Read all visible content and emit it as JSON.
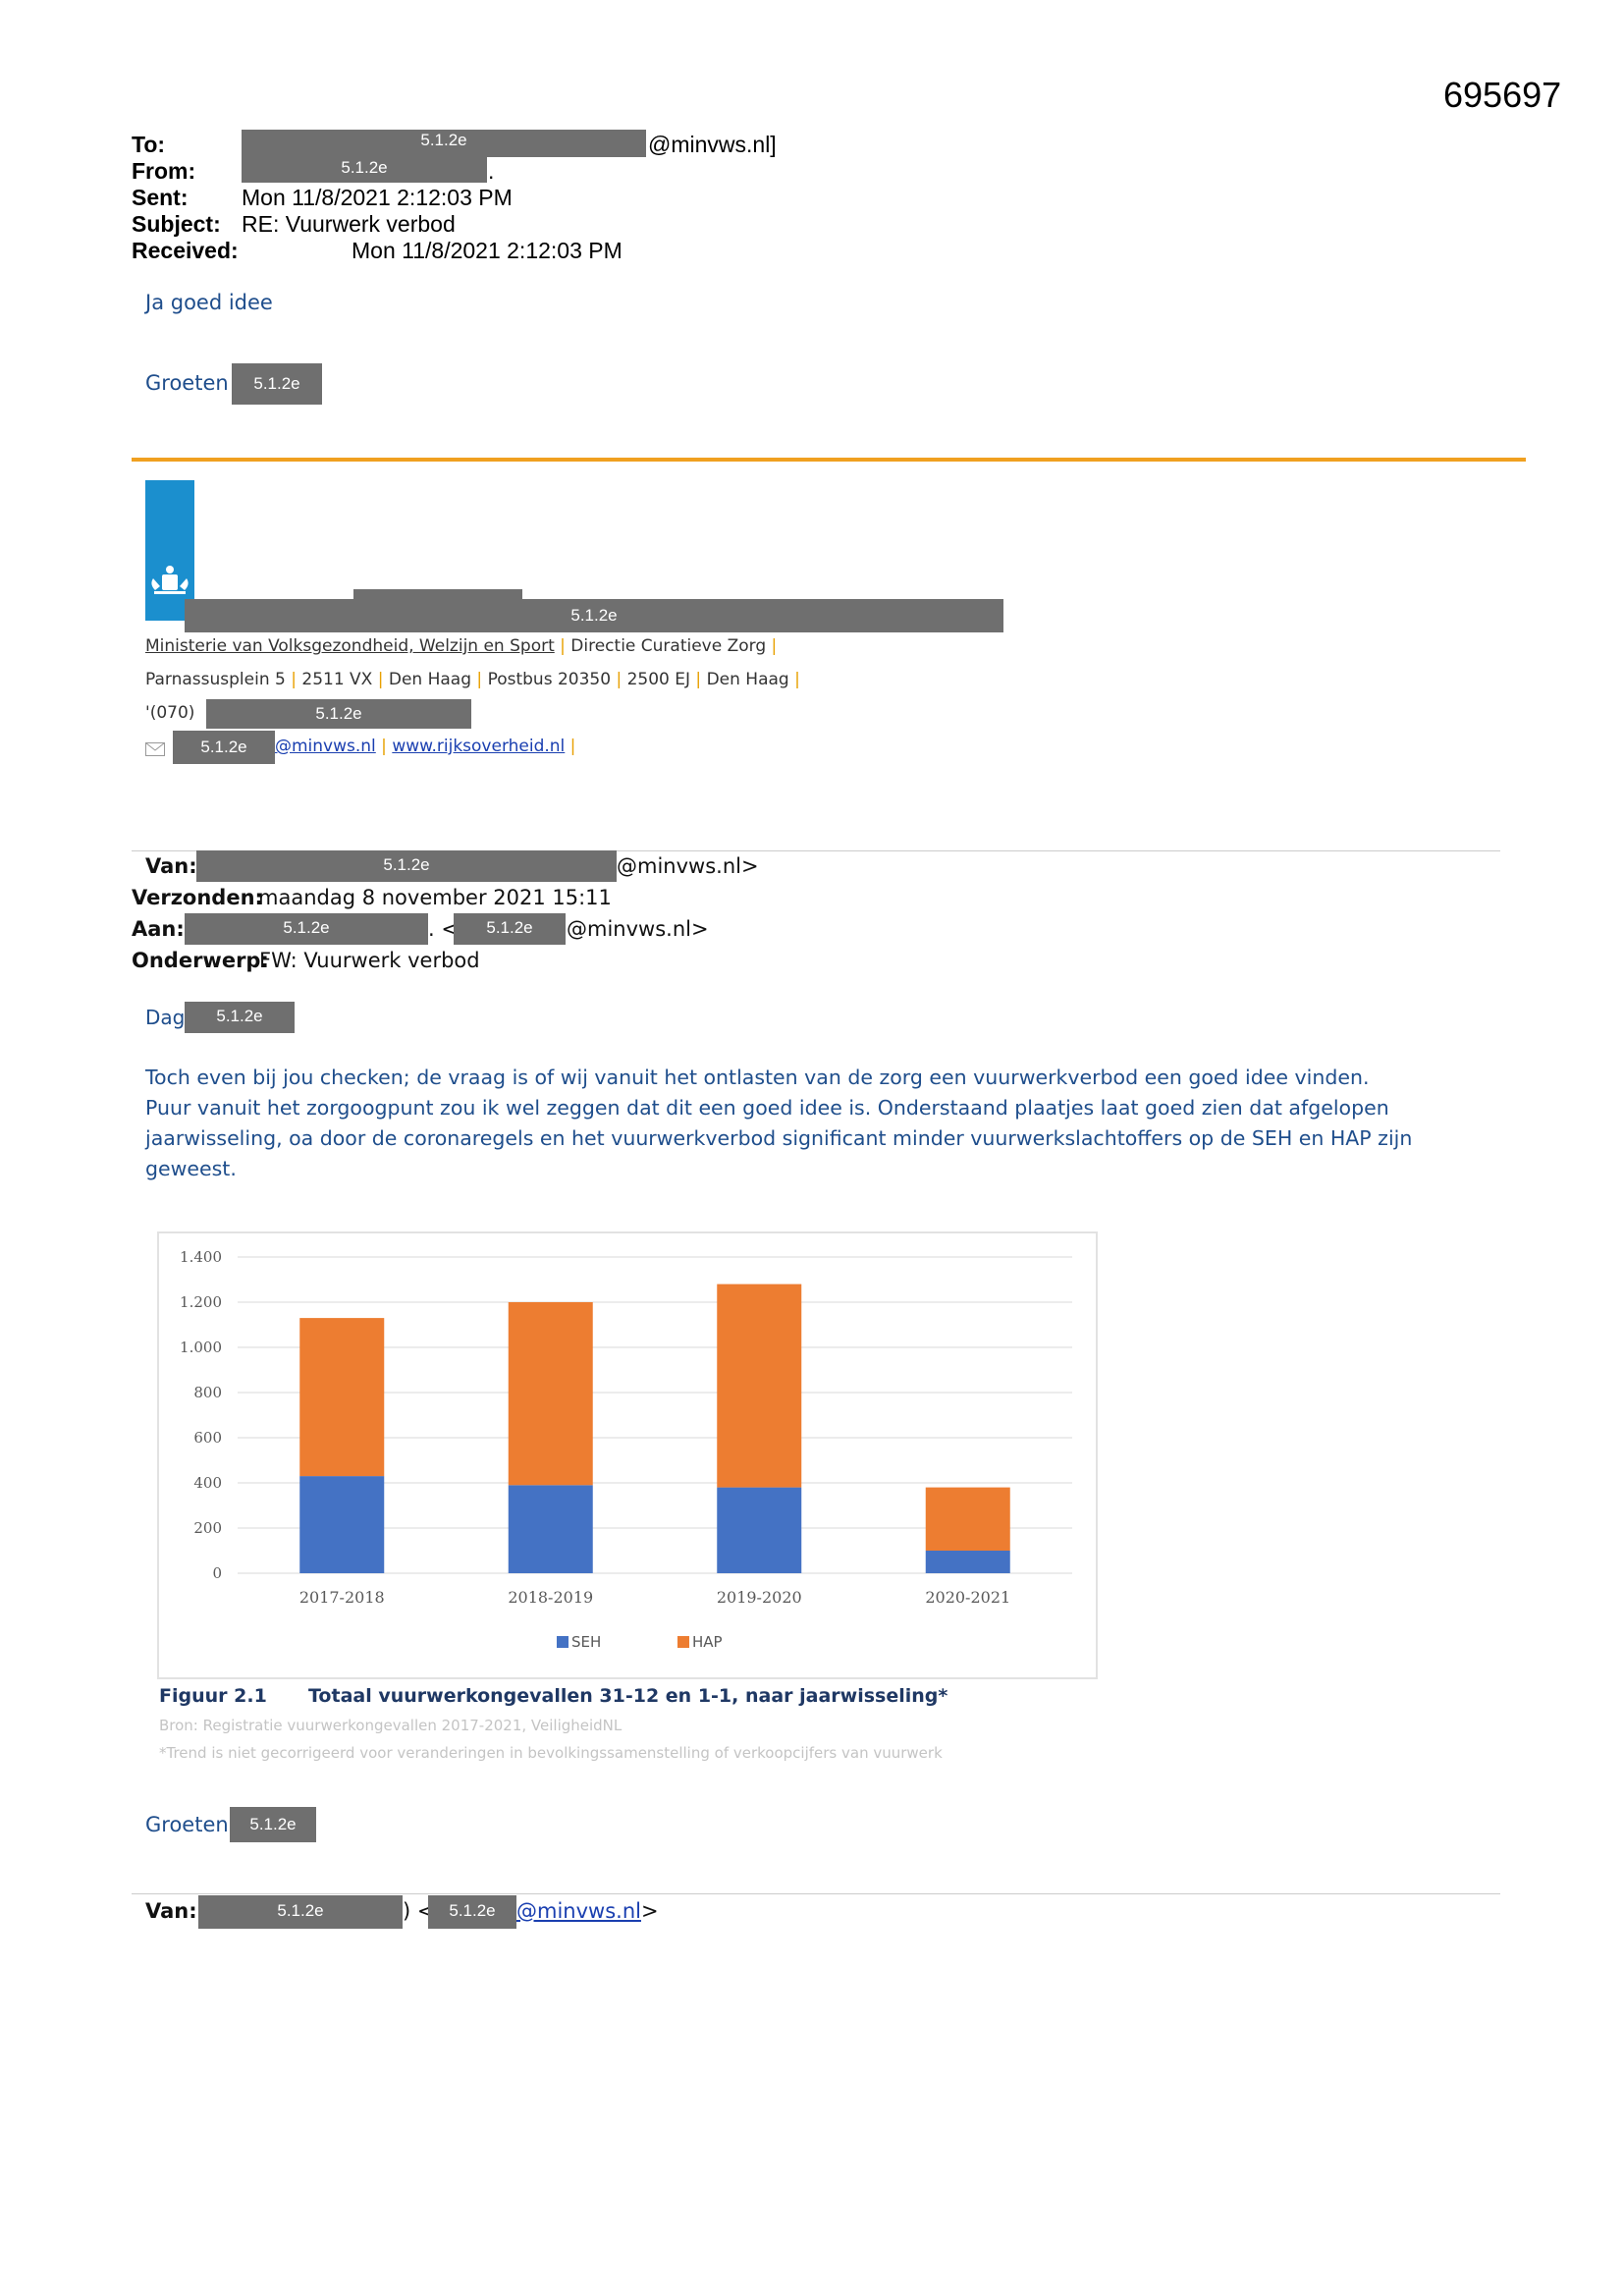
{
  "document_number": "695697",
  "redaction_code": "5.1.2e",
  "header": {
    "to_label": "To:",
    "to_suffix": "@minvws.nl]",
    "from_label": "From:",
    "from_suffix": ".",
    "sent_label": "Sent:",
    "sent_value": "Mon 11/8/2021 2:12:03 PM",
    "subject_label": "Subject:",
    "subject_value": "RE: Vuurwerk verbod",
    "received_label": "Received:",
    "received_value": "Mon 11/8/2021 2:12:03 PM"
  },
  "reply": {
    "line1": "Ja goed idee",
    "greeting": "Groeten"
  },
  "signature": {
    "ministry": "Ministerie van Volksgezondheid, Welzijn en Sport",
    "directorate": "Directie Curatieve Zorg",
    "address_parts": [
      "Parnassusplein 5",
      "2511 VX",
      "Den Haag",
      "Postbus 20350",
      "2500 EJ",
      "Den Haag"
    ],
    "phone_prefix": "(070)",
    "email_suffix": "@minvws.nl",
    "website": "www.rijksoverheid.nl"
  },
  "forwarded": {
    "van_label": "Van:",
    "van_suffix": "@minvws.nl>",
    "verzonden_label": "Verzonden:",
    "verzonden_value": "maandag 8 november 2021 15:11",
    "aan_label": "Aan:",
    "aan_mid": ". <",
    "aan_suffix": "@minvws.nl>",
    "onderwerp_label": "Onderwerp:",
    "onderwerp_value": "FW: Vuurwerk verbod",
    "dag": "Dag",
    "body_lines": [
      "Toch even bij jou checken; de vraag is of wij vanuit het ontlasten van de zorg een vuurwerkverbod een goed idee vinden.",
      "Puur vanuit het zorgoogpunt zou ik wel zeggen dat dit een goed idee is. Onderstaand plaatjes laat goed zien dat afgelopen",
      "jaarwisseling, oa door de coronaregels en het vuurwerkverbod significant minder vuurwerkslachtoffers op de SEH en HAP zijn",
      "geweest."
    ],
    "greeting": "Groeten"
  },
  "chart_data": {
    "type": "bar",
    "stacked": true,
    "categories": [
      "2017-2018",
      "2018-2019",
      "2019-2020",
      "2020-2021"
    ],
    "series": [
      {
        "name": "SEH",
        "values": [
          430,
          390,
          380,
          100
        ],
        "color": "#4472c4"
      },
      {
        "name": "HAP",
        "values": [
          700,
          810,
          900,
          280
        ],
        "color": "#ed7d31"
      }
    ],
    "ylim": [
      0,
      1400
    ],
    "yticks": [
      "0",
      "200",
      "400",
      "600",
      "800",
      "1.000",
      "1.200",
      "1.400"
    ],
    "grid": true,
    "legend": "bottom"
  },
  "figure": {
    "number": "Figuur 2.1",
    "title": "Totaal vuurwerkongevallen 31-12 en 1-1, naar jaarwisseling*",
    "source": "Bron: Registratie vuurwerkongevallen 2017-2021, VeiligheidNL",
    "note": "*Trend is niet gecorrigeerd voor veranderingen in bevolkingssamenstelling of verkoopcijfers van vuurwerk"
  },
  "next_message": {
    "van_label": "Van:",
    "mid": ") <",
    "suffix_link": "@minvws.nl",
    "suffix_end": ">"
  },
  "colors": {
    "accent_rule": "#f0a020",
    "logo_blue": "#1b8fce",
    "redaction": "#6f6f6f"
  }
}
